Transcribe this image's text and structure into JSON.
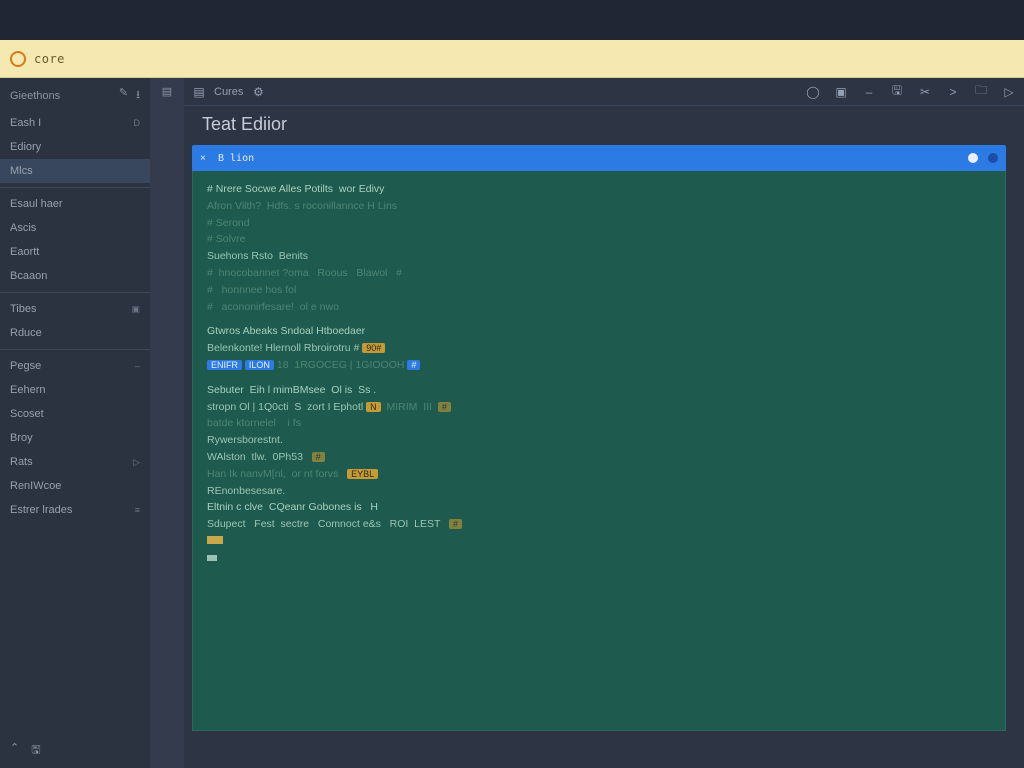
{
  "address_bar": {
    "text": "core"
  },
  "toolbar": {
    "left_label": "Cures",
    "icons_right": [
      "circle-icon",
      "sq-icon",
      "dash-icon",
      "save-icon",
      "clip-icon",
      "term-icon",
      "folder-icon",
      "play-icon"
    ]
  },
  "title": "Teat Ediior",
  "tab": {
    "name": "B lion"
  },
  "sidebar": {
    "header": "Gieethons",
    "hdr_icons": [
      "pencil-icon",
      "ia-icon"
    ],
    "items": [
      {
        "label": "Eash I",
        "meta": "D"
      },
      {
        "label": "Ediory",
        "meta": ""
      },
      {
        "label": "Mlcs",
        "meta": "",
        "active": true
      },
      {
        "label": "Esaul haer",
        "meta": ""
      },
      {
        "label": "Ascis",
        "meta": ""
      },
      {
        "label": "Eaortt",
        "meta": ""
      },
      {
        "label": "Bcaaon",
        "meta": ""
      },
      {
        "label": "Tibes",
        "meta": "▣"
      },
      {
        "label": "Rduce",
        "meta": ""
      },
      {
        "label": "Pegse",
        "meta": "–"
      },
      {
        "label": "Eehern",
        "meta": ""
      },
      {
        "label": "Scoset",
        "meta": ""
      },
      {
        "label": "Broy",
        "meta": ""
      },
      {
        "label": "Rats",
        "meta": "▷"
      },
      {
        "label": "RenIWcoe",
        "meta": ""
      },
      {
        "label": "Estrer lrades",
        "meta": "≡"
      }
    ]
  },
  "code": {
    "l1": "# Nrere Socwe Alles Potilts  wor Edivy",
    "l2": "Afron Vilth?  Hdfs. s roconillannce H Lins",
    "l3": "# Serond",
    "l4": "# Solvre",
    "l5": "Suehons Rsto  Benits",
    "l6": "#  hnocobannet ?oma   Roous   Blawol   #",
    "l7": "#   honnnee hos fol",
    "l8": "#   acononirfesare!  ol e nwo",
    "l9": "Gtwros Abeaks Sndoal Htboedaer",
    "l10_a": "Belenkonte! Hlernoll Rbroirotru #",
    "l10_b": "90#",
    "l11_a": "ENIFR",
    "l11_b": "ILON",
    "l11_c": "18  1RGOCEG | 1GIOOOH",
    "l11_d": "#",
    "l12": "Sebuter  Eih l mimBMsee  Ol is  Ss .",
    "l13_a": "stropn Ol | 1Q0cti  S  zort I Ephotl",
    "l13_b": "N",
    "l13_c": "MIRIM  III",
    "l13_d": "#",
    "l14": "batde ktornelel    i fs",
    "l15": "Rywersborestnt.",
    "l16_a": "WAlston  tlw.  0Ph53",
    "l16_b": "#",
    "l17_a": "Han Ik nanvM[nl,  or nt forvs",
    "l17_b": "EYBL",
    "l18": "REnonbesesare.",
    "l19": "Eltnin c clve  CQeanr Gobones is   H",
    "l20_a": "Sdupect   Fest  sectre   Comnoct e&s   ROI  LEST",
    "l20_b": "#"
  }
}
